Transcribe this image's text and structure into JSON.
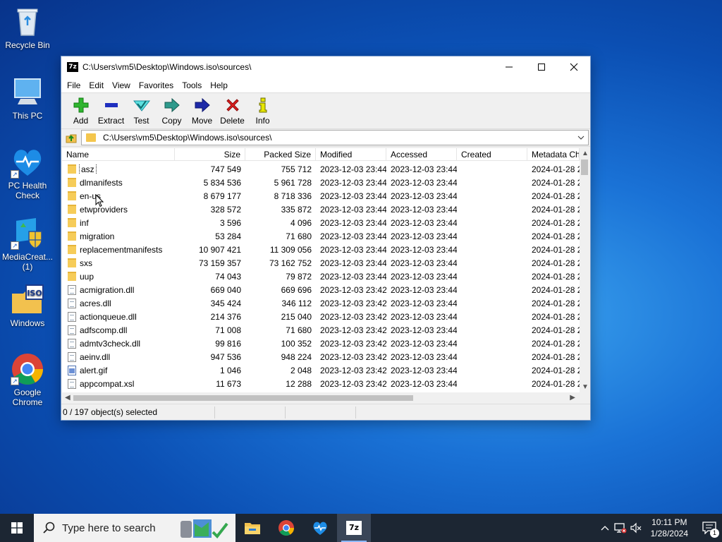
{
  "desktop": {
    "icons": [
      {
        "label": "Recycle Bin"
      },
      {
        "label": "This PC"
      },
      {
        "label": "PC Health Check"
      },
      {
        "label": "MediaCreat... (1)"
      },
      {
        "label": "Windows"
      },
      {
        "label": "Google Chrome"
      }
    ]
  },
  "window": {
    "app_icon": "7z",
    "title": "C:\\Users\\vm5\\Desktop\\Windows.iso\\sources\\",
    "menu": [
      "File",
      "Edit",
      "View",
      "Favorites",
      "Tools",
      "Help"
    ],
    "toolbar": [
      {
        "label": "Add",
        "icon": "add-icon"
      },
      {
        "label": "Extract",
        "icon": "extract-icon"
      },
      {
        "label": "Test",
        "icon": "test-icon"
      },
      {
        "label": "Copy",
        "icon": "copy-icon"
      },
      {
        "label": "Move",
        "icon": "move-icon"
      },
      {
        "label": "Delete",
        "icon": "delete-icon"
      },
      {
        "label": "Info",
        "icon": "info-icon"
      }
    ],
    "address": "C:\\Users\\vm5\\Desktop\\Windows.iso\\sources\\",
    "columns": [
      "Name",
      "Size",
      "Packed Size",
      "Modified",
      "Accessed",
      "Created",
      "Metadata Ch"
    ],
    "rows": [
      {
        "type": "folder",
        "name": "asz",
        "size": "747 549",
        "packed": "755 712",
        "modified": "2023-12-03 23:44",
        "accessed": "2023-12-03 23:44",
        "created": "",
        "meta": "2024-01-28 2"
      },
      {
        "type": "folder",
        "name": "dlmanifests",
        "size": "5 834 536",
        "packed": "5 961 728",
        "modified": "2023-12-03 23:44",
        "accessed": "2023-12-03 23:44",
        "created": "",
        "meta": "2024-01-28 2"
      },
      {
        "type": "folder",
        "name": "en-us",
        "size": "8 679 177",
        "packed": "8 718 336",
        "modified": "2023-12-03 23:44",
        "accessed": "2023-12-03 23:44",
        "created": "",
        "meta": "2024-01-28 2"
      },
      {
        "type": "folder",
        "name": "etwproviders",
        "size": "328 572",
        "packed": "335 872",
        "modified": "2023-12-03 23:44",
        "accessed": "2023-12-03 23:44",
        "created": "",
        "meta": "2024-01-28 2"
      },
      {
        "type": "folder",
        "name": "inf",
        "size": "3 596",
        "packed": "4 096",
        "modified": "2023-12-03 23:44",
        "accessed": "2023-12-03 23:44",
        "created": "",
        "meta": "2024-01-28 2"
      },
      {
        "type": "folder",
        "name": "migration",
        "size": "53 284",
        "packed": "71 680",
        "modified": "2023-12-03 23:44",
        "accessed": "2023-12-03 23:44",
        "created": "",
        "meta": "2024-01-28 2"
      },
      {
        "type": "folder",
        "name": "replacementmanifests",
        "size": "10 907 421",
        "packed": "11 309 056",
        "modified": "2023-12-03 23:44",
        "accessed": "2023-12-03 23:44",
        "created": "",
        "meta": "2024-01-28 2"
      },
      {
        "type": "folder",
        "name": "sxs",
        "size": "73 159 357",
        "packed": "73 162 752",
        "modified": "2023-12-03 23:44",
        "accessed": "2023-12-03 23:44",
        "created": "",
        "meta": "2024-01-28 2"
      },
      {
        "type": "folder",
        "name": "uup",
        "size": "74 043",
        "packed": "79 872",
        "modified": "2023-12-03 23:44",
        "accessed": "2023-12-03 23:44",
        "created": "",
        "meta": "2024-01-28 2"
      },
      {
        "type": "file",
        "name": "acmigration.dll",
        "size": "669 040",
        "packed": "669 696",
        "modified": "2023-12-03 23:42",
        "accessed": "2023-12-03 23:44",
        "created": "",
        "meta": "2024-01-28 2"
      },
      {
        "type": "file",
        "name": "acres.dll",
        "size": "345 424",
        "packed": "346 112",
        "modified": "2023-12-03 23:42",
        "accessed": "2023-12-03 23:44",
        "created": "",
        "meta": "2024-01-28 2"
      },
      {
        "type": "file",
        "name": "actionqueue.dll",
        "size": "214 376",
        "packed": "215 040",
        "modified": "2023-12-03 23:42",
        "accessed": "2023-12-03 23:44",
        "created": "",
        "meta": "2024-01-28 2"
      },
      {
        "type": "file",
        "name": "adfscomp.dll",
        "size": "71 008",
        "packed": "71 680",
        "modified": "2023-12-03 23:42",
        "accessed": "2023-12-03 23:44",
        "created": "",
        "meta": "2024-01-28 2"
      },
      {
        "type": "file",
        "name": "admtv3check.dll",
        "size": "99 816",
        "packed": "100 352",
        "modified": "2023-12-03 23:42",
        "accessed": "2023-12-03 23:44",
        "created": "",
        "meta": "2024-01-28 2"
      },
      {
        "type": "file",
        "name": "aeinv.dll",
        "size": "947 536",
        "packed": "948 224",
        "modified": "2023-12-03 23:42",
        "accessed": "2023-12-03 23:44",
        "created": "",
        "meta": "2024-01-28 2"
      },
      {
        "type": "image",
        "name": "alert.gif",
        "size": "1 046",
        "packed": "2 048",
        "modified": "2023-12-03 23:42",
        "accessed": "2023-12-03 23:44",
        "created": "",
        "meta": "2024-01-28 2"
      },
      {
        "type": "file",
        "name": "appcompat.xsl",
        "size": "11 673",
        "packed": "12 288",
        "modified": "2023-12-03 23:42",
        "accessed": "2023-12-03 23:44",
        "created": "",
        "meta": "2024-01-28 2"
      }
    ],
    "status": "0 / 197 object(s) selected"
  },
  "taskbar": {
    "search_placeholder": "Type here to search",
    "apps": [
      "file-explorer-icon",
      "chrome-icon",
      "pc-health-icon",
      "7zip-icon"
    ],
    "clock_time": "10:11 PM",
    "clock_date": "1/28/2024",
    "notifications": "1"
  },
  "colors": {
    "accent": "#0b4fb3",
    "taskbar": "#1c2633",
    "folder": "#f6cc59"
  }
}
